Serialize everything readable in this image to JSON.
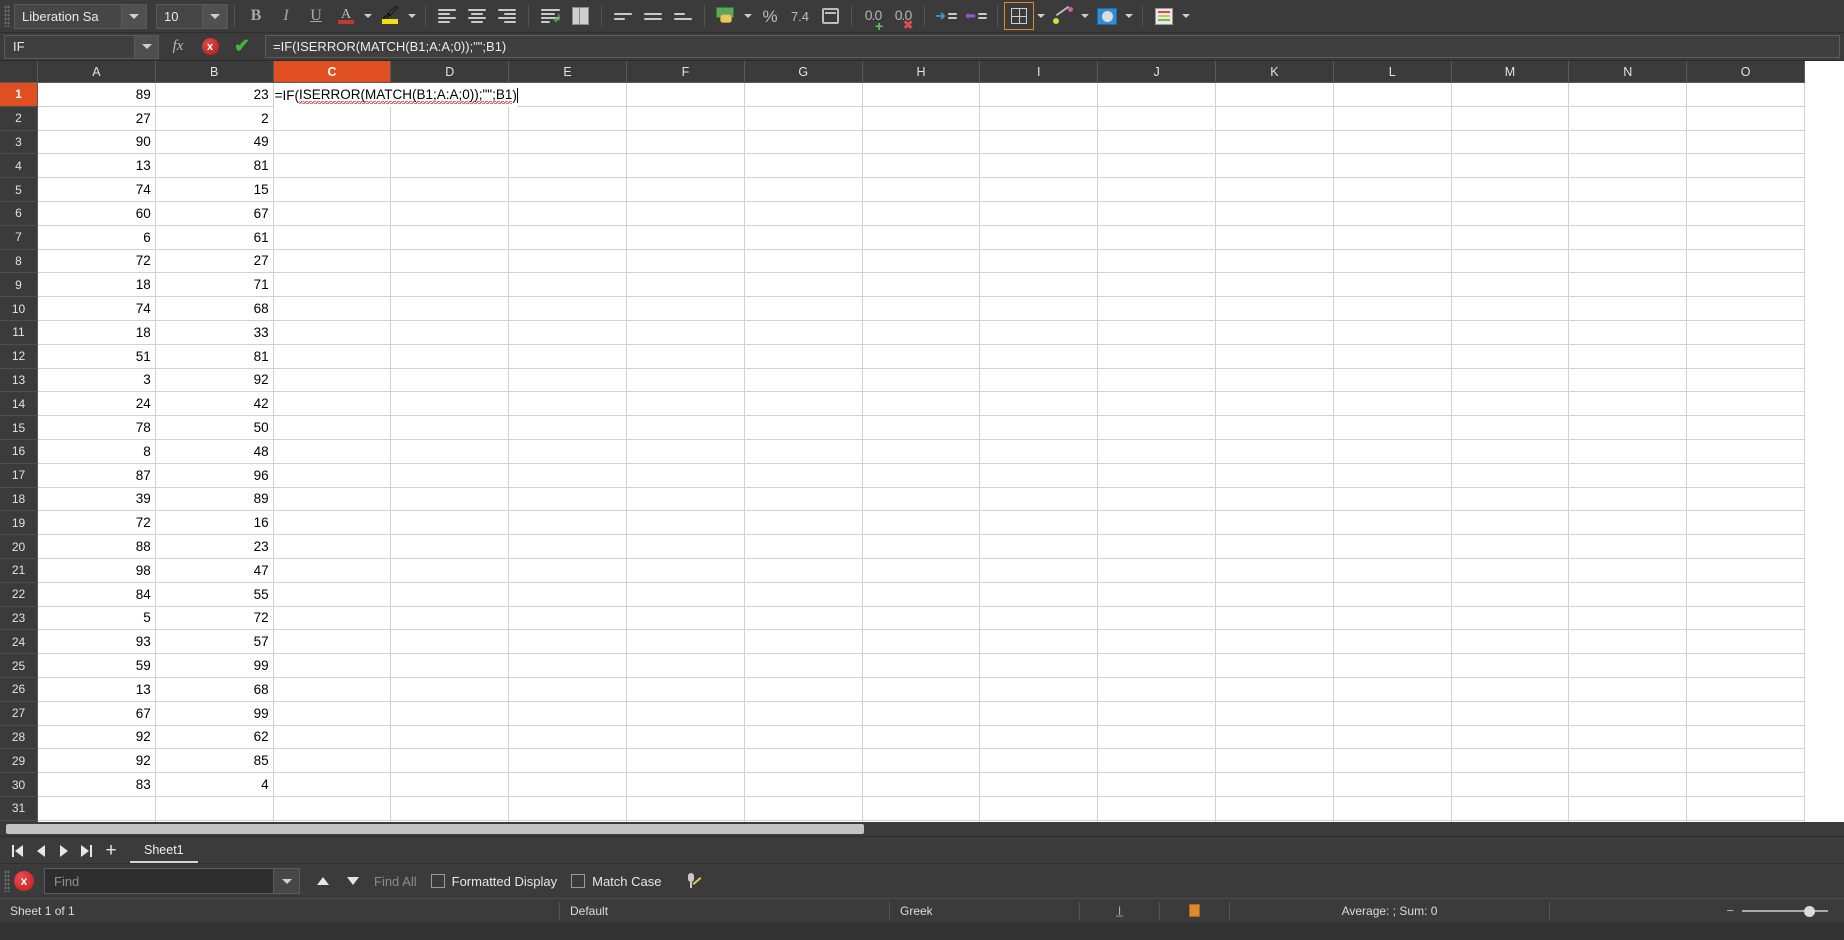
{
  "toolbar": {
    "font_name": "Liberation Sa",
    "font_size": "10",
    "buttons": [
      {
        "name": "bold",
        "label": "B"
      },
      {
        "name": "italic",
        "label": "I"
      },
      {
        "name": "underline",
        "label": "U"
      },
      {
        "name": "font-color",
        "label": "A"
      },
      {
        "name": "highlight-color",
        "label": ""
      },
      {
        "name": "align-left",
        "label": ""
      },
      {
        "name": "align-center",
        "label": ""
      },
      {
        "name": "align-right",
        "label": ""
      },
      {
        "name": "wrap-text",
        "label": ""
      },
      {
        "name": "merge-cells",
        "label": ""
      },
      {
        "name": "align-top",
        "label": ""
      },
      {
        "name": "align-middle",
        "label": ""
      },
      {
        "name": "align-bottom",
        "label": ""
      },
      {
        "name": "format-currency",
        "label": ""
      },
      {
        "name": "format-percent",
        "label": "%"
      },
      {
        "name": "format-number",
        "label": "7.4"
      },
      {
        "name": "format-date",
        "label": ""
      },
      {
        "name": "add-decimal",
        "label": "0.0"
      },
      {
        "name": "delete-decimal",
        "label": "0.0"
      },
      {
        "name": "increase-indent",
        "label": ""
      },
      {
        "name": "decrease-indent",
        "label": ""
      },
      {
        "name": "borders",
        "label": ""
      },
      {
        "name": "border-style",
        "label": ""
      },
      {
        "name": "background-color",
        "label": ""
      },
      {
        "name": "conditional-format",
        "label": ""
      }
    ]
  },
  "formula_bar": {
    "name_box": "IF",
    "fx_label": "fx",
    "cancel_label": "x",
    "accept_label": "✔",
    "formula": "=IF(ISERROR(MATCH(B1;A:A;0));\"\";B1)"
  },
  "grid": {
    "columns": [
      "A",
      "B",
      "C",
      "D",
      "E",
      "F",
      "G",
      "H",
      "I",
      "J",
      "K",
      "L",
      "M",
      "N",
      "O"
    ],
    "active_column": "C",
    "active_row": 1,
    "row_count": 32,
    "cell_edit": {
      "address": "C1",
      "text_before": "=IF(",
      "text_squiggled": "ISERROR(MATCH(B1;A:A;0));\"\";B1",
      "text_after": ")"
    },
    "data": {
      "A": [
        89,
        27,
        90,
        13,
        74,
        60,
        6,
        72,
        18,
        74,
        18,
        51,
        3,
        24,
        78,
        8,
        87,
        39,
        72,
        88,
        98,
        84,
        5,
        93,
        59,
        13,
        67,
        92,
        92,
        83
      ],
      "B": [
        23,
        2,
        49,
        81,
        15,
        67,
        61,
        27,
        71,
        68,
        33,
        81,
        92,
        42,
        50,
        48,
        96,
        89,
        16,
        23,
        47,
        55,
        72,
        57,
        99,
        68,
        99,
        62,
        85,
        4
      ]
    }
  },
  "sheet_bar": {
    "first_label": "❘◀",
    "prev_label": "◀",
    "next_label": "▶",
    "last_label": "▶❘",
    "add_label": "+",
    "tabs": [
      {
        "name": "Sheet1",
        "label": "Sheet1",
        "active": true
      }
    ]
  },
  "find_bar": {
    "close_label": "x",
    "placeholder": "Find",
    "value": "",
    "find_previous_label": "↑",
    "find_next_label": "↓",
    "find_all_label": "Find All",
    "formatted_display_label": "Formatted Display",
    "formatted_display_checked": false,
    "match_case_label": "Match Case",
    "match_case_checked": false,
    "similarity_search_label": ""
  },
  "status_bar": {
    "sheet_info": "Sheet 1 of 1",
    "page_style": "Default",
    "language": "Greek",
    "insert_mode": "",
    "selection_mode": "",
    "average_sum": "Average: ; Sum: 0"
  },
  "colors": {
    "accent": "#e04f22",
    "toolbar_bg": "#3b3b3b",
    "grid_bg": "#ffffff",
    "grid_line": "#d0d0d0",
    "spell_error": "#e03b3b"
  }
}
